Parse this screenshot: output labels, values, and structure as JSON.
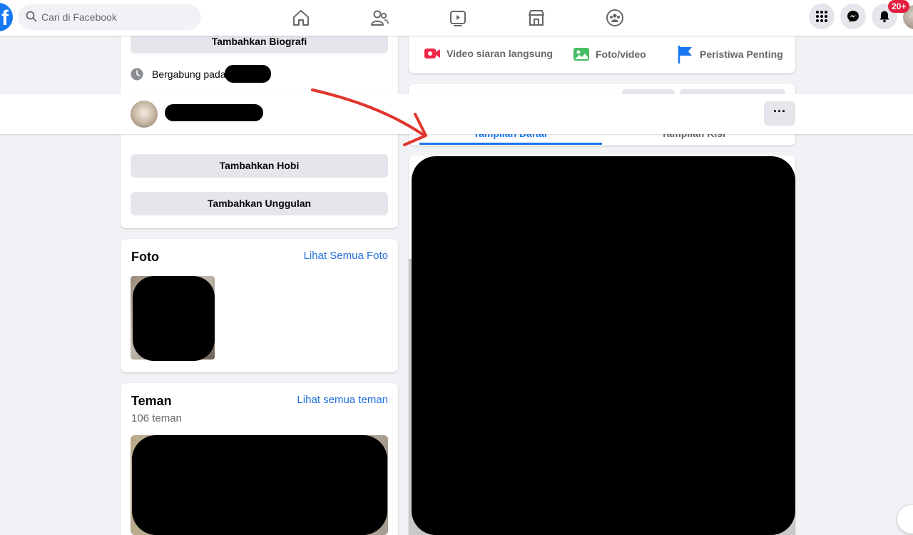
{
  "topbar": {
    "search_placeholder": "Cari di Facebook",
    "notification_badge": "20+",
    "nav_icons": [
      "home-icon",
      "friends-icon",
      "watch-icon",
      "marketplace-icon",
      "groups-icon"
    ],
    "right_icons": [
      "menu-grid-icon",
      "messenger-icon",
      "notifications-bell-icon",
      "profile-avatar"
    ]
  },
  "intro": {
    "add_bio": "Tambahkan Biografi",
    "joined_prefix": "Bergabung pada",
    "add_hobbies": "Tambahkan Hobi",
    "add_featured": "Tambahkan Unggulan"
  },
  "photos": {
    "title": "Foto",
    "see_all": "Lihat Semua Foto"
  },
  "friends": {
    "title": "Teman",
    "see_all": "Lihat semua teman",
    "count": "106 teman"
  },
  "composer": {
    "live_video": "Video siaran langsung",
    "photo_video": "Foto/video",
    "life_event": "Peristiwa Penting"
  },
  "view_tabs": {
    "list": "Tampilan Daftar",
    "grid": "Tampilan Kisi"
  },
  "sticky": {
    "more_label": "···"
  },
  "colors": {
    "brand_blue": "#1877f2",
    "link_blue": "#216fdb",
    "annotation_red": "#e0362c",
    "badge_red": "#e41e3f"
  }
}
